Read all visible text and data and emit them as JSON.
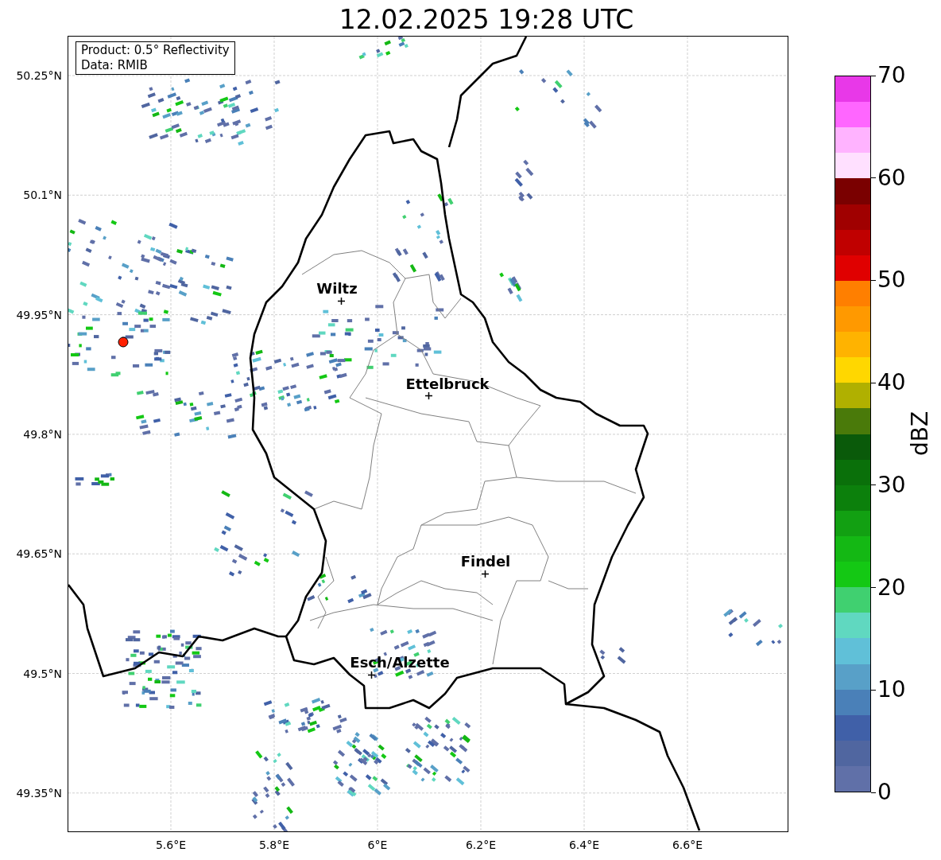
{
  "title": "12.02.2025 19:28 UTC",
  "info_box": {
    "lines": [
      "Product: 0.5° Reflectivity",
      "Data: RMIB"
    ]
  },
  "map": {
    "lat_labels": [
      "50.25°N",
      "50.1°N",
      "49.95°N",
      "49.8°N",
      "49.65°N",
      "49.5°N",
      "49.35°N"
    ],
    "lon_labels": [
      "5.6°E",
      "5.8°E",
      "6°E",
      "6.2°E",
      "6.4°E",
      "6.6°E"
    ],
    "cities": [
      {
        "name": "Wiltz"
      },
      {
        "name": "Ettelbruck"
      },
      {
        "name": "Findel"
      },
      {
        "name": "Esch/Alzette"
      }
    ]
  },
  "colorbar": {
    "label": "dBZ",
    "ticks": [
      "70",
      "60",
      "50",
      "40",
      "30",
      "20",
      "10",
      "0"
    ],
    "bands": [
      {
        "color": "#e838e8"
      },
      {
        "color": "#ff66ff"
      },
      {
        "color": "#ffb3ff"
      },
      {
        "color": "#ffe0ff"
      },
      {
        "color": "#7a0000"
      },
      {
        "color": "#a00000"
      },
      {
        "color": "#c00000"
      },
      {
        "color": "#e00000"
      },
      {
        "color": "#ff7f00"
      },
      {
        "color": "#ff9900"
      },
      {
        "color": "#ffb300"
      },
      {
        "color": "#ffd700"
      },
      {
        "color": "#b0b000"
      },
      {
        "color": "#4a7a0a"
      },
      {
        "color": "#0a5a0a"
      },
      {
        "color": "#0a700a"
      },
      {
        "color": "#0c800c"
      },
      {
        "color": "#12a012"
      },
      {
        "color": "#14b814"
      },
      {
        "color": "#14c814"
      },
      {
        "color": "#40d070"
      },
      {
        "color": "#60d8c0"
      },
      {
        "color": "#60c0d8"
      },
      {
        "color": "#58a0c8"
      },
      {
        "color": "#4a80b8"
      },
      {
        "color": "#4060a8"
      },
      {
        "color": "#5066a0"
      },
      {
        "color": "#6070a8"
      }
    ]
  }
}
